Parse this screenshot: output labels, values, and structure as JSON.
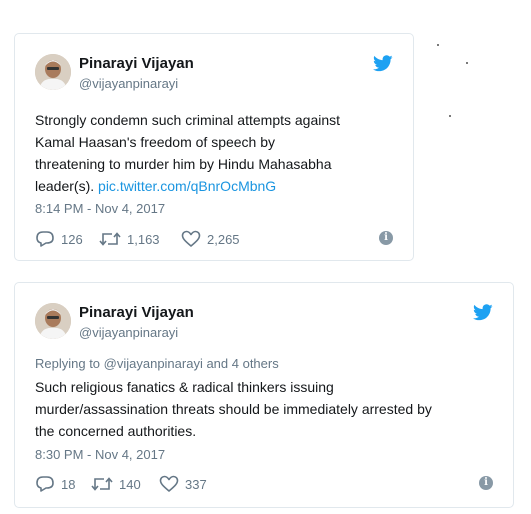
{
  "tweets": [
    {
      "display_name": "Pinarayi Vijayan",
      "handle": "@vijayanpinarayi",
      "text_lines": [
        "Strongly condemn such criminal attempts against",
        "Kamal Haasan's freedom of speech by",
        "threatening to murder him by Hindu Mahasabha"
      ],
      "text_last_prefix": "leader(s). ",
      "link": "pic.twitter.com/qBnrOcMbnG",
      "timestamp": "8:14 PM - Nov 4, 2017",
      "replies": "126",
      "retweets": "1,163",
      "likes": "2,265",
      "icons": {
        "reply": "reply-icon",
        "retweet": "retweet-icon",
        "like": "heart-icon",
        "info": "info-icon",
        "brand": "twitter-bird-icon"
      }
    },
    {
      "display_name": "Pinarayi Vijayan",
      "handle": "@vijayanpinarayi",
      "reply_to": "Replying to @vijayanpinarayi and 4 others",
      "text_lines": [
        "Such religious fanatics & radical thinkers issuing",
        "murder/assassination threats should be immediately arrested by",
        "the concerned authorities."
      ],
      "timestamp": "8:30 PM - Nov 4, 2017",
      "replies": "18",
      "retweets": "140",
      "likes": "337",
      "icons": {
        "reply": "reply-icon",
        "retweet": "retweet-icon",
        "like": "heart-icon",
        "info": "info-icon",
        "brand": "twitter-bird-icon"
      }
    }
  ],
  "colors": {
    "link": "#1b95e0",
    "brand": "#1da1f2",
    "secondary_text": "#657786",
    "border": "#e1e8ed"
  }
}
